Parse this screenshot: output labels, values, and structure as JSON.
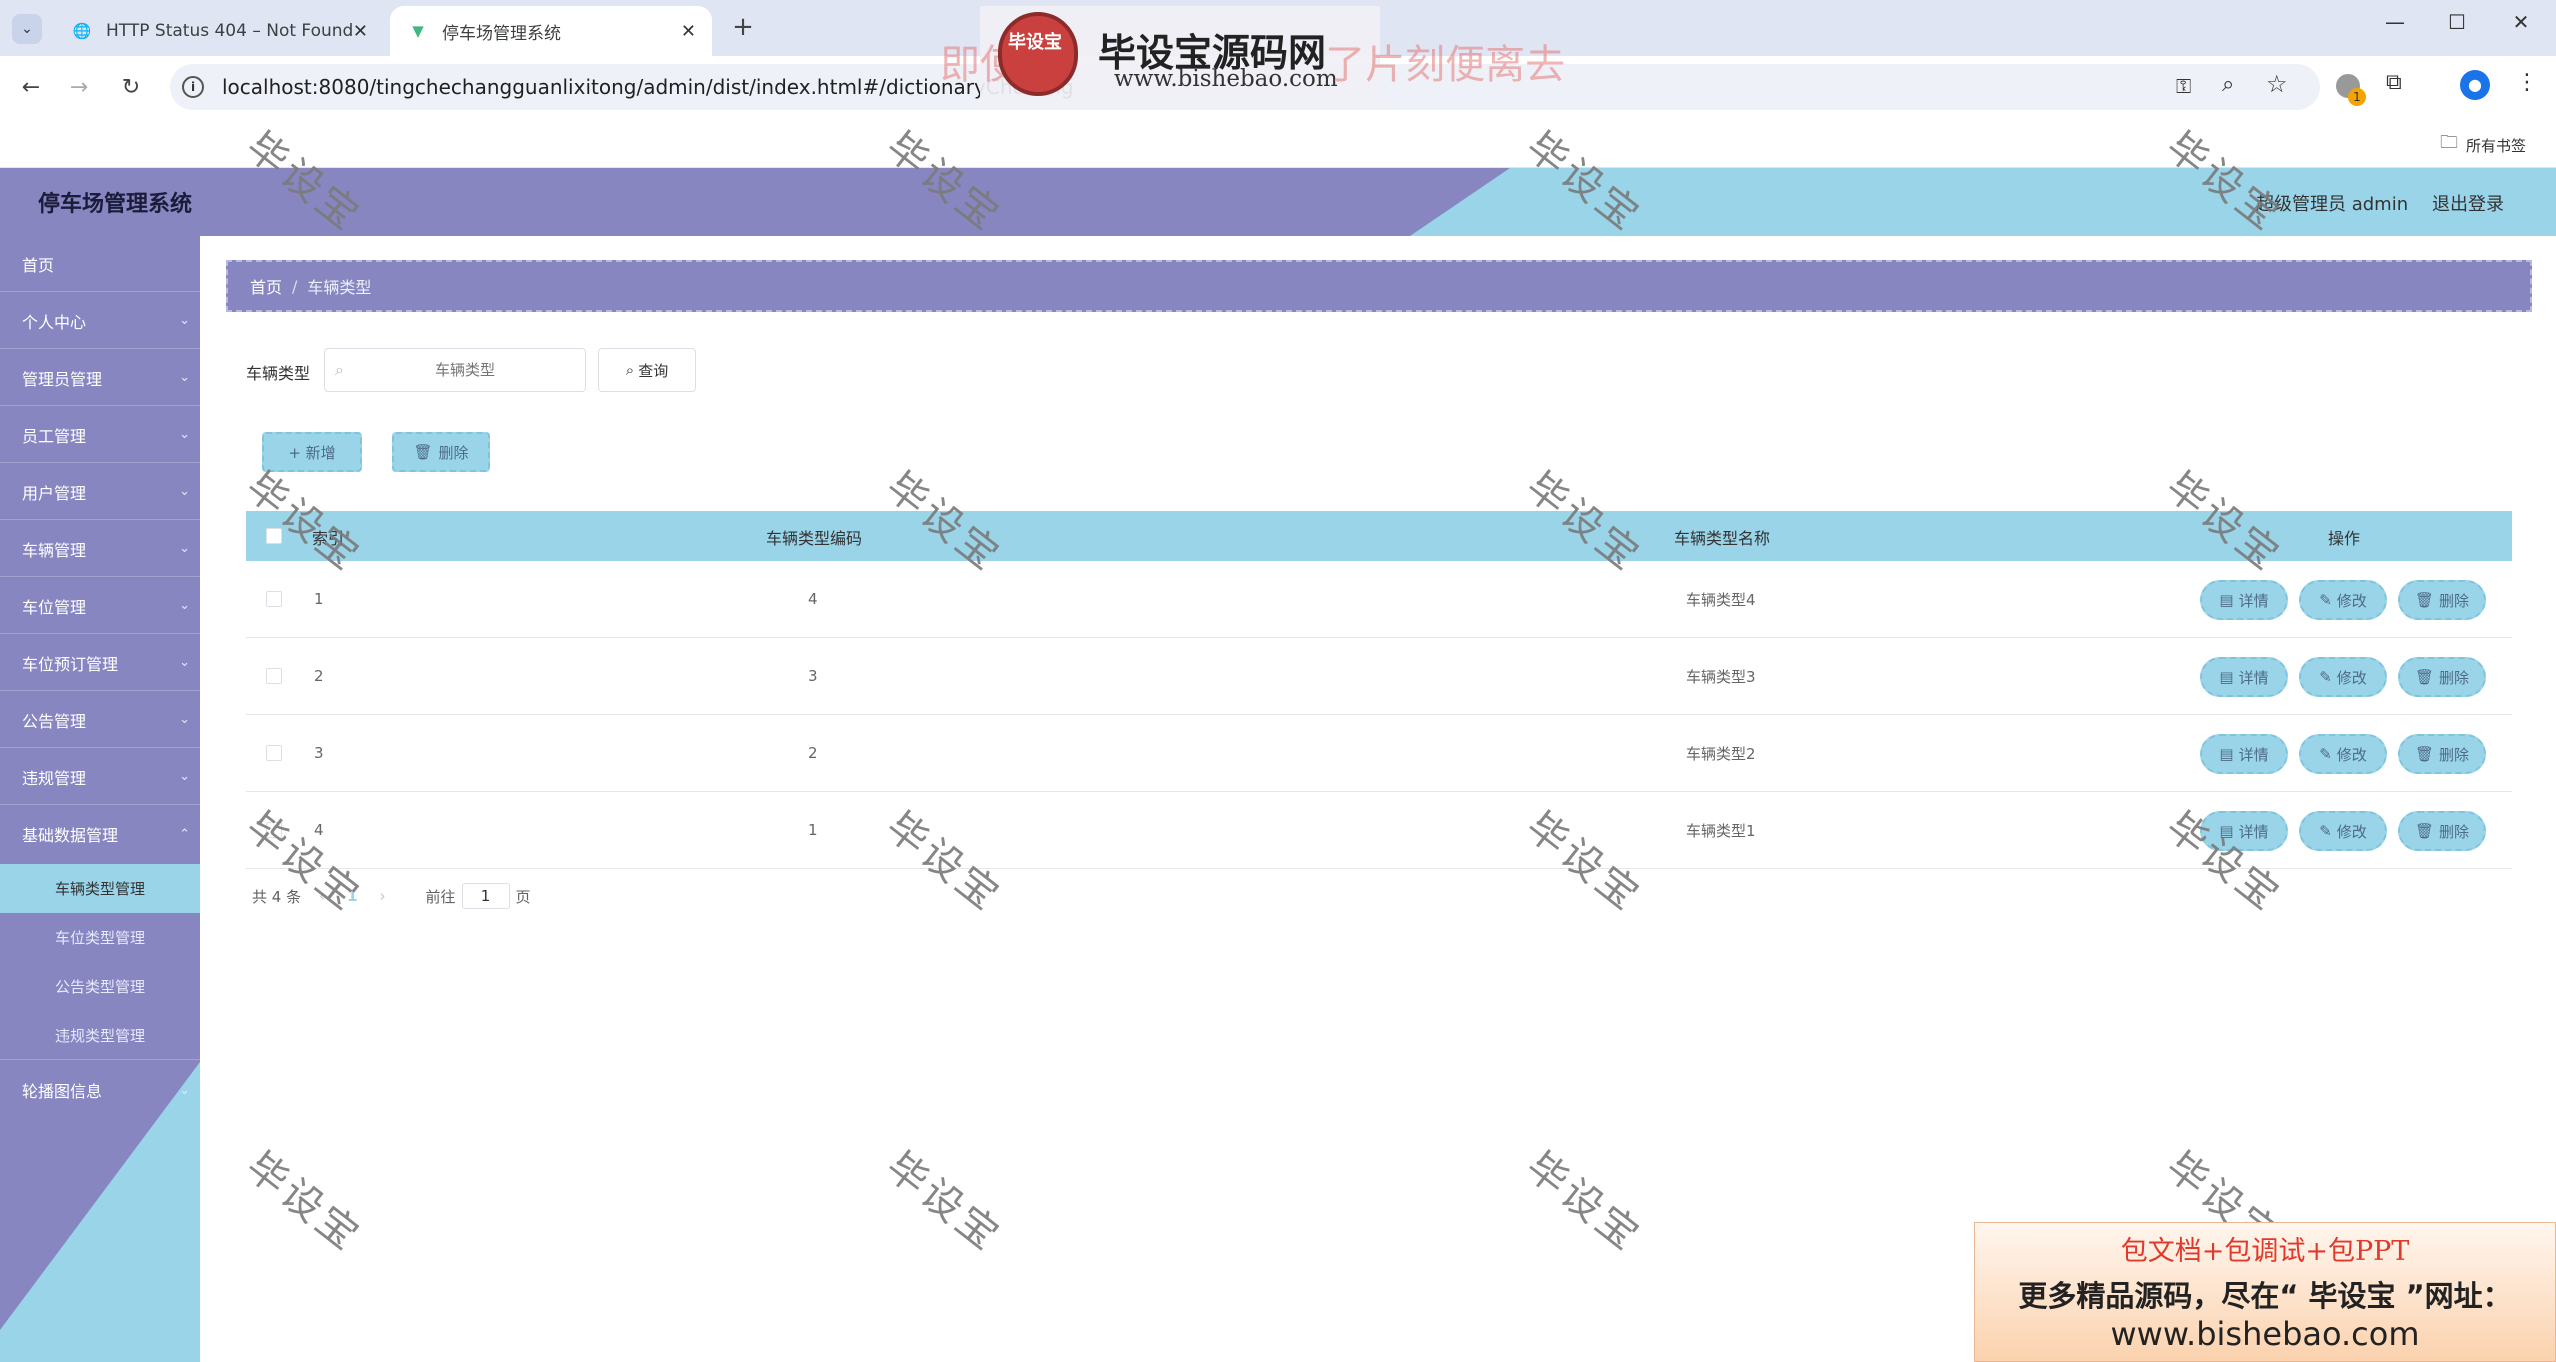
{
  "browser": {
    "tabs": [
      {
        "title": "HTTP Status 404 – Not Found"
      },
      {
        "title": "停车场管理系统"
      }
    ],
    "url": "localhost:8080/tingchechangguanlixitong/admin/dist/index.html#/dictionaryCheliang",
    "bookmarks_label": "所有书签",
    "extension_badge": "1"
  },
  "promo_banner": {
    "brand": "毕设宝源码网",
    "url": "www.bishebao.com",
    "logo_text": "毕设宝",
    "faded_text": "即使                        了片刻便离去"
  },
  "app": {
    "title": "停车场管理系统",
    "user_label": "超级管理员 admin",
    "logout_label": "退出登录"
  },
  "sidebar": {
    "items": [
      {
        "label": "首页"
      },
      {
        "label": "个人中心"
      },
      {
        "label": "管理员管理"
      },
      {
        "label": "员工管理"
      },
      {
        "label": "用户管理"
      },
      {
        "label": "车辆管理"
      },
      {
        "label": "车位管理"
      },
      {
        "label": "车位预订管理"
      },
      {
        "label": "公告管理"
      },
      {
        "label": "违规管理"
      },
      {
        "label": "基础数据管理"
      }
    ],
    "subitems": [
      {
        "label": "车辆类型管理"
      },
      {
        "label": "车位类型管理"
      },
      {
        "label": "公告类型管理"
      },
      {
        "label": "违规类型管理"
      }
    ],
    "last_item": {
      "label": "轮播图信息"
    }
  },
  "breadcrumb": {
    "home": "首页",
    "separator": "/",
    "current": "车辆类型"
  },
  "search": {
    "label": "车辆类型",
    "placeholder": "车辆类型",
    "query_label": "查询"
  },
  "actions": {
    "add_label": "+ 新增",
    "delete_label": "删除"
  },
  "table": {
    "headers": [
      "索引",
      "车辆类型编码",
      "车辆类型名称",
      "操作"
    ],
    "rows": [
      {
        "index": "1",
        "code": "4",
        "name": "车辆类型4"
      },
      {
        "index": "2",
        "code": "3",
        "name": "车辆类型3"
      },
      {
        "index": "3",
        "code": "2",
        "name": "车辆类型2"
      },
      {
        "index": "4",
        "code": "1",
        "name": "车辆类型1"
      }
    ],
    "row_actions": {
      "detail": "详情",
      "edit": "修改",
      "delete": "删除"
    }
  },
  "pagination": {
    "total": "共 4 条",
    "current_page": "1",
    "goto_label": "前往",
    "goto_value": "1",
    "page_suffix": "页"
  },
  "watermark": {
    "text": "毕设宝"
  },
  "ad": {
    "line1": "包文档+包调试+包PPT",
    "line2": "更多精品源码，尽在“ 毕设宝 ”网址：",
    "line3": "www.bishebao.com"
  },
  "colors": {
    "purple": "#8786c0",
    "light_blue": "#9ad4e8"
  }
}
